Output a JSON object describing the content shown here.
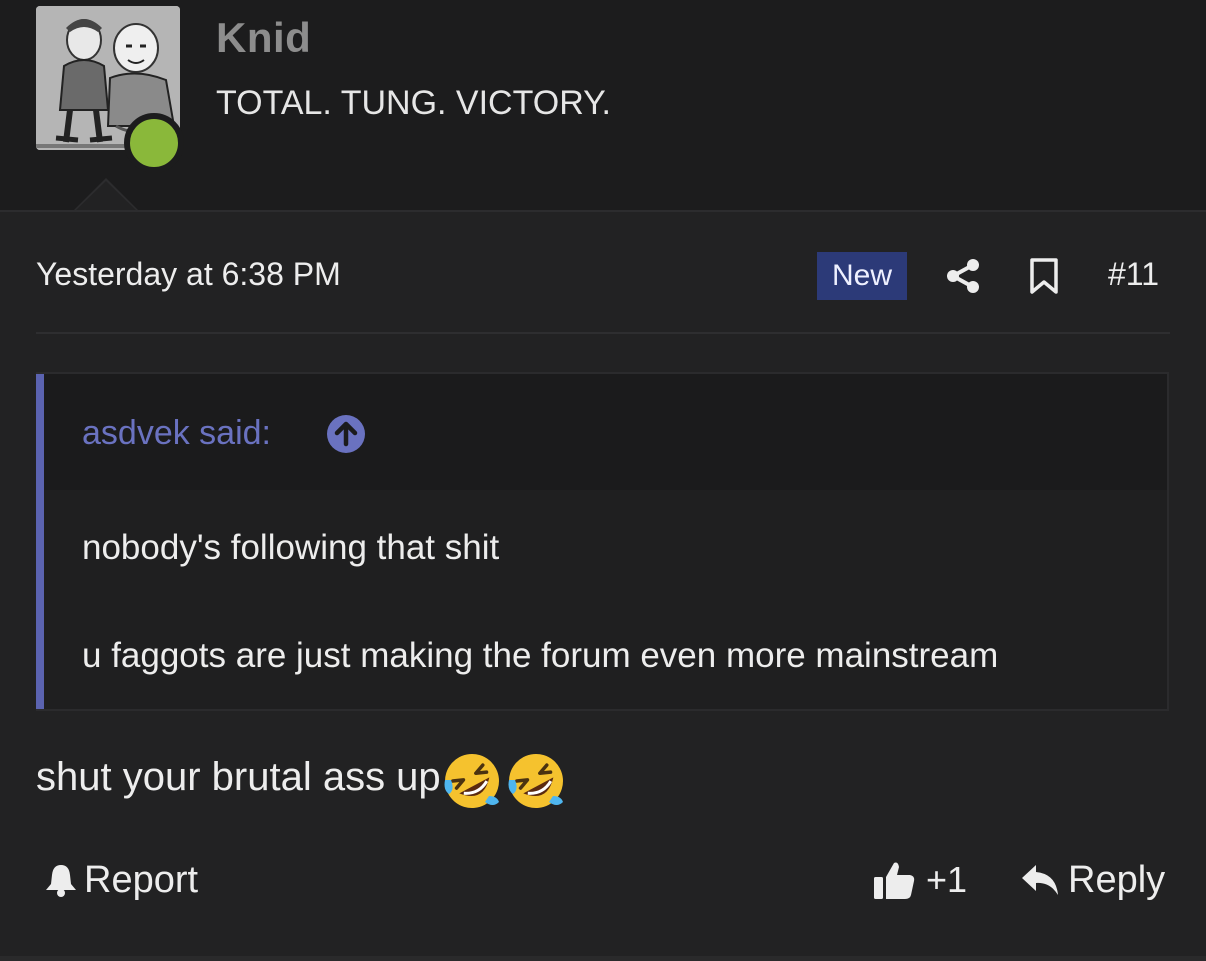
{
  "user": {
    "name": "Knid",
    "title": "TOTAL. TUNG. VICTORY.",
    "status": "online",
    "status_color": "#8ab83a"
  },
  "post": {
    "timestamp": "Yesterday at 6:38 PM",
    "badge": "New",
    "badge_color": "#2c3a78",
    "number": "#11",
    "icons": [
      "share-icon",
      "bookmark-icon"
    ]
  },
  "quote": {
    "author_label": "asdvek said:",
    "accent_color": "#5b63b0",
    "lines": [
      "nobody's following that shit",
      "u faggots are just making the forum even more mainstream"
    ]
  },
  "reply": {
    "text": "shut your brutal ass up",
    "emoji": [
      "rolling-on-floor-laughing-emoji",
      "rolling-on-floor-laughing-emoji"
    ]
  },
  "actions": {
    "report_label": "Report",
    "like_label": "+1",
    "reply_label": "Reply"
  }
}
